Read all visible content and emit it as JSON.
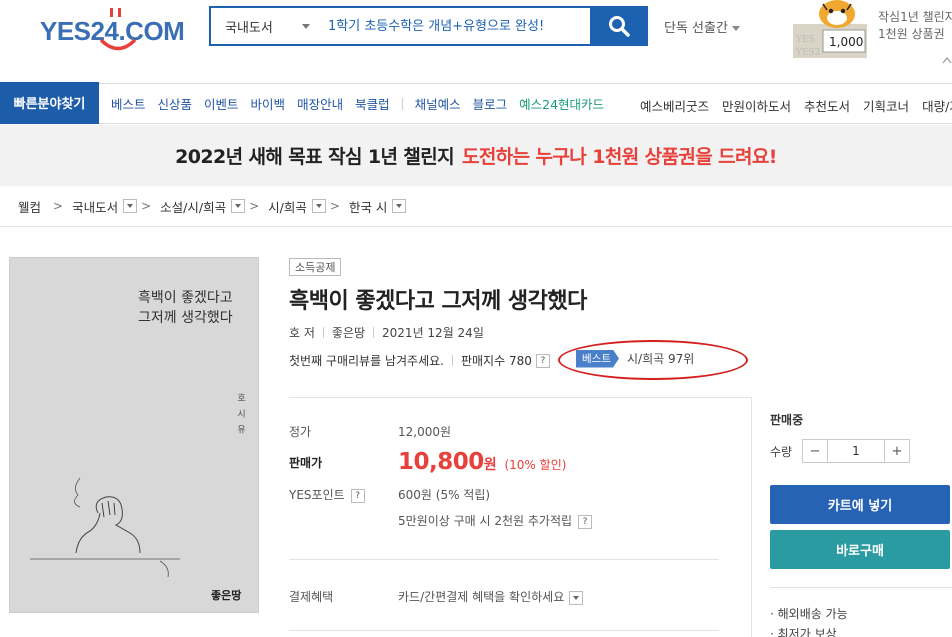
{
  "header": {
    "logo_text": "YES24.COM",
    "search_category": "국내도서",
    "search_placeholder": "1학기 초등수학은 개념+유형으로 완성!",
    "curation_label": "단독 선출간",
    "promo_line1": "작심1년 챌린지",
    "promo_line2": "1천원 상품권",
    "promo_amount": "1,000"
  },
  "nav": {
    "quick_label": "빠른분야찾기",
    "menu": [
      "베스트",
      "신상품",
      "이벤트",
      "바이백",
      "매장안내",
      "북클럽",
      "채널예스",
      "블로그",
      "예스24현대카드"
    ],
    "right_menu": [
      "예스베리굿즈",
      "만원이하도서",
      "추천도서",
      "기획코너",
      "대량/기"
    ]
  },
  "banner": {
    "text_a": "2022년 새해 목표 작심 1년 챌린지",
    "text_b": "도전하는 누구나 1천원 상품권을 드려요!"
  },
  "breadcrumb": {
    "home": "웰컴",
    "items": [
      "국내도서",
      "소설/시/희곡",
      "시/희곡",
      "한국 시"
    ]
  },
  "book": {
    "cover_title_line1": "흑백이 좋겠다고",
    "cover_title_line2": "그저께 생각했다",
    "cover_author": "호 시 유",
    "cover_publisher": "좋은땅",
    "deduction_badge": "소득공제",
    "title": "흑백이 좋겠다고 그저께 생각했다",
    "author": "호 저",
    "publisher": "좋은땅",
    "date": "2021년 12월 24일",
    "review_prompt": "첫번째 구매리뷰를 남겨주세요.",
    "sales_index": "판매지수 780",
    "help_q": "?",
    "best_tag": "베스트",
    "best_rank": "시/희곡 97위"
  },
  "price": {
    "list_label": "정가",
    "list_value": "12,000원",
    "sale_label": "판매가",
    "sale_value": "10,800",
    "sale_unit": "원",
    "discount": "(10% 할인)",
    "point_label": "YES포인트",
    "point_value": "600원 (5% 적립)",
    "extra_point": "5만원이상 구매 시 2천원 추가적립",
    "benefit_label": "결제혜택",
    "benefit_value": "카드/간편결제 혜택을 확인하세요"
  },
  "buy": {
    "status": "판매중",
    "qty_label": "수량",
    "qty_value": "1",
    "minus": "−",
    "plus": "+",
    "cart_label": "카트에 넣기",
    "buy_label": "바로구매",
    "note1": "· 해외배송 가능",
    "note2": "· 최저가 보상"
  },
  "colors": {
    "brand_blue": "#1c62b0",
    "sale_red": "#e8403a",
    "buy_teal": "#2b9ba2"
  }
}
